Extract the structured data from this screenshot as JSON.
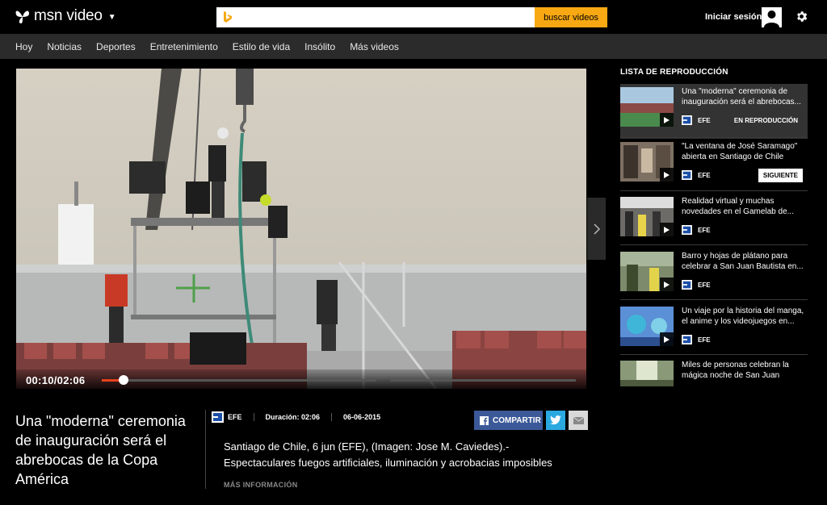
{
  "header": {
    "logo_text": "msn video",
    "search_placeholder": "",
    "search_button": "buscar videos",
    "signin": "Iniciar sesión"
  },
  "nav": {
    "items": [
      "Hoy",
      "Noticias",
      "Deportes",
      "Entretenimiento",
      "Estilo de vida",
      "Insólito",
      "Más videos"
    ]
  },
  "player": {
    "timecode": "00:10/02:06",
    "progress_fraction": 0.079
  },
  "video_info": {
    "title": "Una \"moderna\" ceremonia de inauguración será el abrebocas de la Copa América",
    "source": "EFE",
    "duration": "Duración: 02:06",
    "date": "06-06-2015",
    "share_label": "COMPARTIR",
    "description": "Santiago de Chile, 6 jun (EFE), (Imagen: Jose M. Caviedes).- Espectaculares fuegos artificiales, iluminación y acrobacias imposibles",
    "more_info": "MÁS INFORMACIÓN"
  },
  "playlist": {
    "header": "LISTA DE REPRODUCCIÓN",
    "items": [
      {
        "title": "Una \"moderna\" ceremonia de inauguración será el abrebocas...",
        "source": "EFE",
        "status": "EN REPRODUCCIÓN"
      },
      {
        "title": "\"La ventana de José Saramago\" abierta en Santiago de Chile",
        "source": "EFE",
        "status": "SIGUIENTE"
      },
      {
        "title": "Realidad virtual y muchas novedades en el Gamelab de...",
        "source": "EFE",
        "status": ""
      },
      {
        "title": "Barro y hojas de plátano para celebrar a San Juan Bautista en...",
        "source": "EFE",
        "status": ""
      },
      {
        "title": "Un viaje por la historia del manga, el anime y los videojuegos en...",
        "source": "EFE",
        "status": ""
      },
      {
        "title": "Miles de personas celebran la mágica noche de San Juan",
        "source": "",
        "status": ""
      }
    ]
  },
  "colors": {
    "accent": "#f7a812",
    "progress": "#e8421c",
    "facebook": "#3b5998",
    "twitter": "#2aa9e0"
  }
}
